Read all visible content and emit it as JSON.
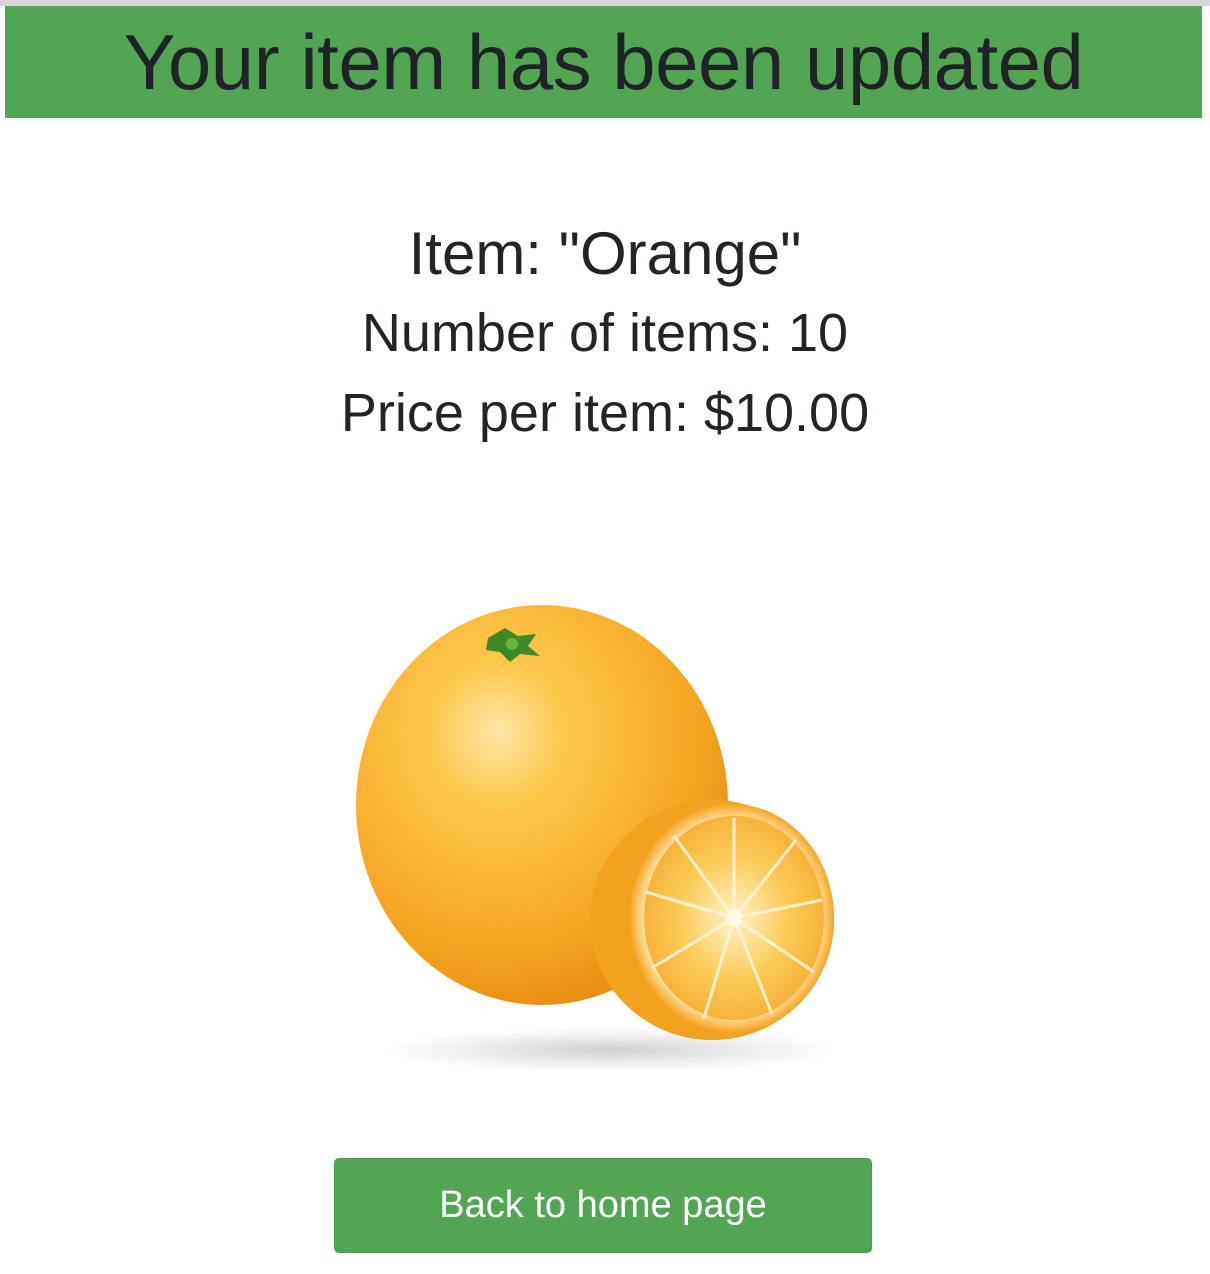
{
  "banner": {
    "message": "Your item has been updated",
    "color": "#52a552"
  },
  "item": {
    "name_line": "Item: \"Orange\"",
    "quantity_line": "Number of items: 10",
    "price_line": "Price per item: $10.00"
  },
  "image": {
    "subject": "orange-fruit-illustration"
  },
  "actions": {
    "back_label": "Back to home page",
    "button_color": "#52a552"
  }
}
